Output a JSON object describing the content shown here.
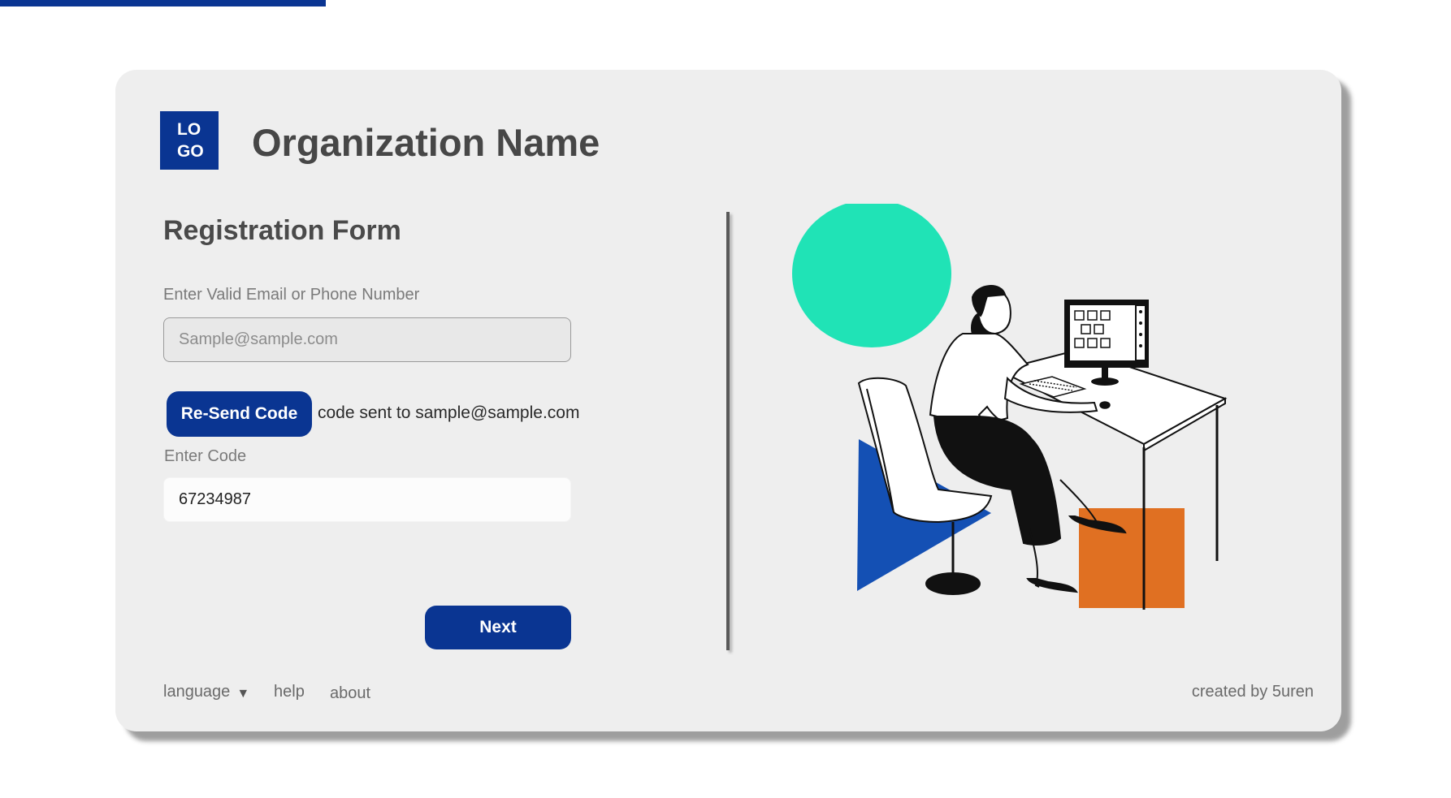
{
  "logo": {
    "line1": "LO",
    "line2": "GO"
  },
  "header": {
    "org_name": "Organization Name"
  },
  "form": {
    "title": "Registration Form",
    "email_label": "Enter Valid Email or Phone Number",
    "email_placeholder": "Sample@sample.com",
    "resend_label": "Re-Send Code",
    "sent_message": "code sent to sample@sample.com",
    "code_label": "Enter Code",
    "code_value": "67234987",
    "next_label": "Next"
  },
  "footer": {
    "language_label": "language",
    "help_label": "help",
    "about_label": "about",
    "credit": "created by 5uren"
  },
  "icons": {
    "language_caret": "caret-down-icon"
  },
  "colors": {
    "brand": "#0a3592",
    "card_bg": "#eeeeee",
    "teal": "#20e3b6",
    "blue": "#1450b4",
    "orange": "#e07022"
  }
}
